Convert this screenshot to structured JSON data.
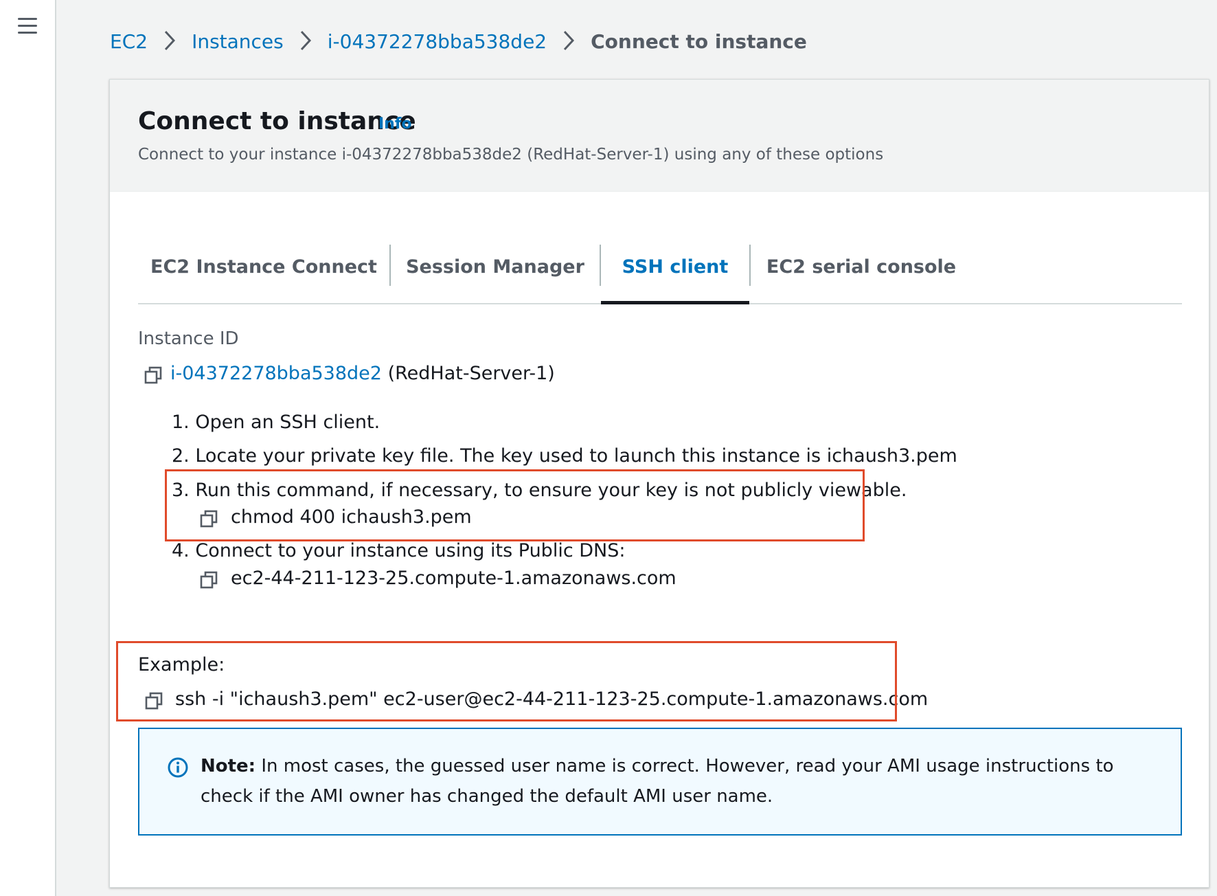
{
  "breadcrumb": {
    "items": [
      "EC2",
      "Instances",
      "i-04372278bba538de2"
    ],
    "current": "Connect to instance"
  },
  "panel": {
    "title": "Connect to instance",
    "info": "Info",
    "subtitle": "Connect to your instance i-04372278bba538de2 (RedHat-Server-1) using any of these options"
  },
  "tabs": [
    {
      "label": "EC2 Instance Connect",
      "active": false
    },
    {
      "label": "Session Manager",
      "active": false
    },
    {
      "label": "SSH client",
      "active": true
    },
    {
      "label": "EC2 serial console",
      "active": false
    }
  ],
  "instance": {
    "label": "Instance ID",
    "id": "i-04372278bba538de2",
    "name": "(RedHat-Server-1)"
  },
  "steps": [
    {
      "text": "1. Open an SSH client."
    },
    {
      "text": "2. Locate your private key file. The key used to launch this instance is ichaush3.pem"
    },
    {
      "text": "3. Run this command, if necessary, to ensure your key is not publicly viewable.",
      "command": "chmod 400 ichaush3.pem"
    },
    {
      "text": "4. Connect to your instance using its Public DNS:",
      "command": "ec2-44-211-123-25.compute-1.amazonaws.com"
    }
  ],
  "example": {
    "label": "Example:",
    "command": "ssh -i \"ichaush3.pem\" ec2-user@ec2-44-211-123-25.compute-1.amazonaws.com"
  },
  "note": {
    "label": "Note:",
    "text": " In most cases, the guessed user name is correct. However, read your AMI usage instructions to check if the AMI owner has changed the default AMI user name."
  },
  "colors": {
    "link": "#0073bb",
    "highlight": "#e04b2b",
    "note_bg": "#f1faff"
  },
  "icons": [
    "menu-icon",
    "chevron-right-icon",
    "copy-icon",
    "info-circle-icon"
  ]
}
